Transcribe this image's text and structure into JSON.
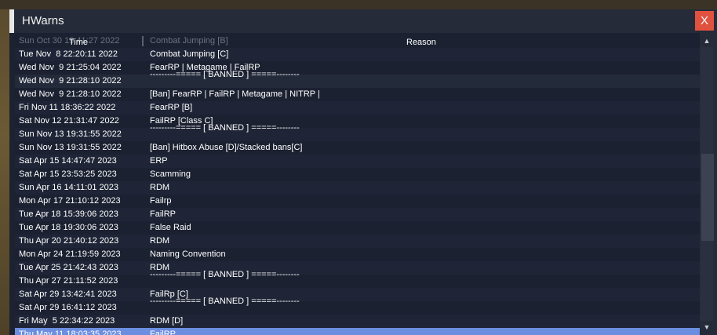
{
  "window": {
    "title": "HWarns",
    "close_label": "X"
  },
  "columns": {
    "time": "Time",
    "reason": "Reason"
  },
  "rows": [
    {
      "time": "Sun Oct 30 19:41:27 2022",
      "reason": "Combat Jumping [B]",
      "faded": true
    },
    {
      "time": "Tue Nov  8 22:20:11 2022",
      "reason": "Combat Jumping [C]"
    },
    {
      "time": "Wed Nov  9 21:25:04 2022",
      "reason": "FearRP | Metagame | FailRP"
    },
    {
      "time": "Wed Nov  9 21:28:10 2022",
      "reason": "---------===== [ BANNED ] =====--------",
      "banner": true
    },
    {
      "time": "Wed Nov  9 21:28:10 2022",
      "reason": "[Ban] FearRP | FailRP | Metagame | NITRP |"
    },
    {
      "time": "Fri Nov 11 18:36:22 2022",
      "reason": "FearRP [B]"
    },
    {
      "time": "Sat Nov 12 21:31:47 2022",
      "reason": "FailRP [Class C]"
    },
    {
      "time": "Sun Nov 13 19:31:55 2022",
      "reason": "---------===== [ BANNED ] =====--------",
      "banner": true
    },
    {
      "time": "Sun Nov 13 19:31:55 2022",
      "reason": "[Ban] Hitbox Abuse [D]/Stacked bans[C]"
    },
    {
      "time": "Sat Apr 15 14:47:47 2023",
      "reason": "ERP"
    },
    {
      "time": "Sat Apr 15 23:53:25 2023",
      "reason": "Scamming"
    },
    {
      "time": "Sun Apr 16 14:11:01 2023",
      "reason": "RDM"
    },
    {
      "time": "Mon Apr 17 21:10:12 2023",
      "reason": "Failrp"
    },
    {
      "time": "Tue Apr 18 15:39:06 2023",
      "reason": "FailRP"
    },
    {
      "time": "Tue Apr 18 19:30:06 2023",
      "reason": "False Raid"
    },
    {
      "time": "Thu Apr 20 21:40:12 2023",
      "reason": "RDM"
    },
    {
      "time": "Mon Apr 24 21:19:59 2023",
      "reason": "Naming Convention"
    },
    {
      "time": "Tue Apr 25 21:42:43 2023",
      "reason": "RDM"
    },
    {
      "time": "Thu Apr 27 21:11:52 2023",
      "reason": "---------===== [ BANNED ] =====--------",
      "banner": true
    },
    {
      "time": "Sat Apr 29 13:42:41 2023",
      "reason": "FailRp [C]"
    },
    {
      "time": "Sat Apr 29 16:41:12 2023",
      "reason": "---------===== [ BANNED ] =====--------",
      "banner": true
    },
    {
      "time": "Fri May  5 22:34:22 2023",
      "reason": "RDM [D]"
    },
    {
      "time": "Thu May 11 18:03:35 2023",
      "reason": "FailRP",
      "selected": true
    }
  ],
  "colors": {
    "accent": "#e0523f",
    "selected": "#6b8ee0",
    "panel": "#1b2131"
  }
}
